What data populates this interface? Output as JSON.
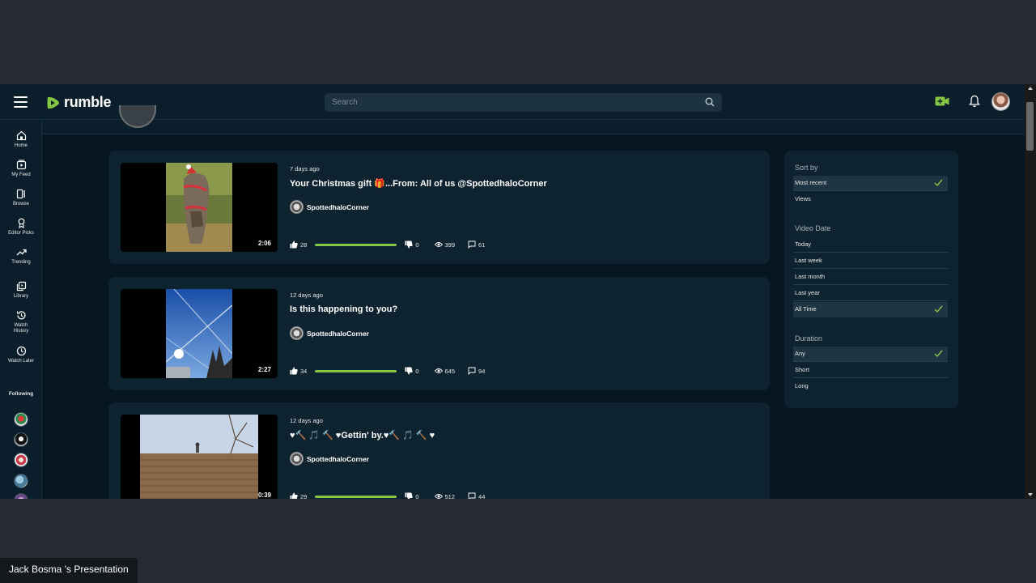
{
  "topbar": {
    "brand": "rumble",
    "search_placeholder": "Search"
  },
  "sidebar": {
    "items": [
      {
        "label": "Home"
      },
      {
        "label": "My Feed"
      },
      {
        "label": "Browse"
      },
      {
        "label": "Editor Picks"
      },
      {
        "label": "Trending"
      },
      {
        "label": "Library"
      },
      {
        "label": "Watch History"
      },
      {
        "label": "Watch Later"
      }
    ],
    "following_label": "Following"
  },
  "videos": [
    {
      "date": "7 days ago",
      "title": "Your Christmas gift 🎁...From: All of us @SpottedhaloCorner",
      "channel": "SpottedhaloCorner",
      "duration": "2:06",
      "likes": "28",
      "dislikes": "0",
      "views": "399",
      "comments": "61",
      "like_ratio": 1.0
    },
    {
      "date": "12 days ago",
      "title": "Is this happening to you?",
      "channel": "SpottedhaloCorner",
      "duration": "2:27",
      "likes": "34",
      "dislikes": "0",
      "views": "645",
      "comments": "94",
      "like_ratio": 1.0
    },
    {
      "date": "12 days ago",
      "title": "♥🔨 🎵 🔨 ♥Gettin' by.♥🔨 🎵 🔨 ♥",
      "channel": "SpottedhaloCorner",
      "duration": "0:39",
      "likes": "29",
      "dislikes": "0",
      "views": "512",
      "comments": "44",
      "like_ratio": 1.0
    }
  ],
  "filters": {
    "sort_by": {
      "heading": "Sort by",
      "options": [
        "Most recent",
        "Views"
      ],
      "selected": "Most recent"
    },
    "video_date": {
      "heading": "Video Date",
      "options": [
        "Today",
        "Last week",
        "Last month",
        "Last year",
        "All Time"
      ],
      "selected": "All Time"
    },
    "duration": {
      "heading": "Duration",
      "options": [
        "Any",
        "Short",
        "Long"
      ],
      "selected": "Any"
    }
  },
  "presentation_label": "Jack Bosma 's Presentation",
  "colors": {
    "brand_green": "#85c742",
    "background": "#061721",
    "card": "#0e2330"
  }
}
